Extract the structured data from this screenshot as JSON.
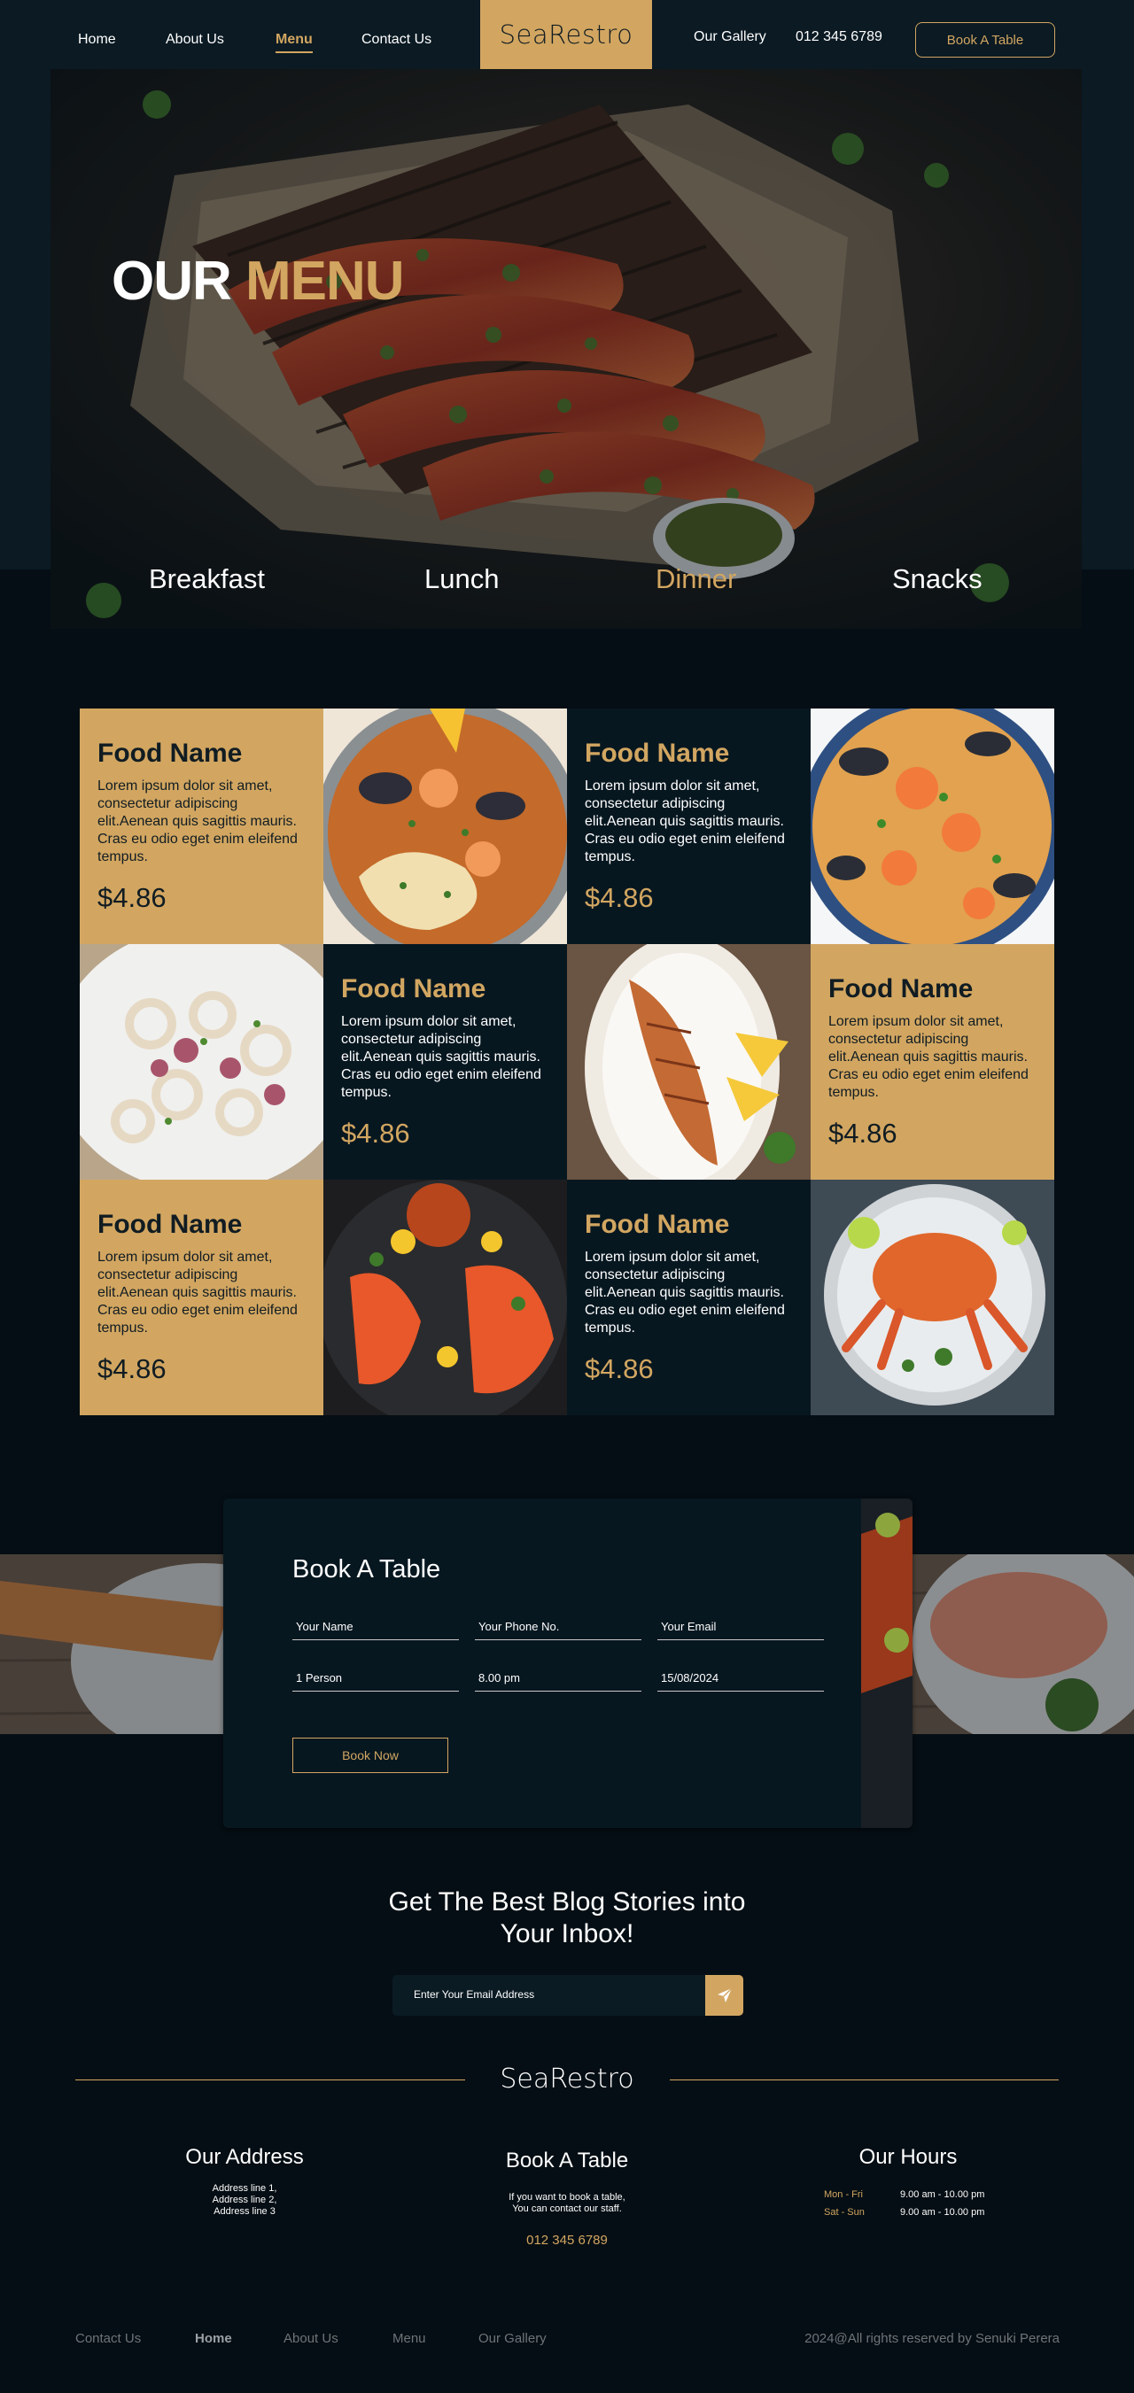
{
  "nav": {
    "links": [
      "Home",
      "About Us",
      "Menu",
      "Contact Us"
    ],
    "active": "Menu",
    "brand": "SeaRestro",
    "gallery": "Our Gallery",
    "phone": "012 345 6789",
    "cta": "Book A Table"
  },
  "hero": {
    "title_part1": "OUR",
    "title_part2": "MENU",
    "categories": [
      "Breakfast",
      "Lunch",
      "Dinner",
      "Snacks"
    ],
    "active_category": "Dinner"
  },
  "menu": {
    "items": [
      {
        "name": "Food Name",
        "description": "Lorem ipsum dolor sit amet, consectetur adipiscing elit.Aenean quis sagittis mauris. Cras eu odio eget enim eleifend tempus.",
        "price": "$4.86"
      },
      {
        "name": "Food Name",
        "description": "Lorem ipsum dolor sit amet, consectetur adipiscing elit.Aenean quis sagittis mauris. Cras eu odio eget enim eleifend tempus.",
        "price": "$4.86"
      },
      {
        "name": "Food Name",
        "description": "Lorem ipsum dolor sit amet, consectetur adipiscing elit.Aenean quis sagittis mauris. Cras eu odio eget enim eleifend tempus.",
        "price": "$4.86"
      },
      {
        "name": "Food Name",
        "description": "Lorem ipsum dolor sit amet, consectetur adipiscing elit.Aenean quis sagittis mauris. Cras eu odio eget enim eleifend tempus.",
        "price": "$4.86"
      },
      {
        "name": "Food Name",
        "description": "Lorem ipsum dolor sit amet, consectetur adipiscing elit.Aenean quis sagittis mauris. Cras eu odio eget enim eleifend tempus.",
        "price": "$4.86"
      },
      {
        "name": "Food Name",
        "description": "Lorem ipsum dolor sit amet, consectetur adipiscing elit.Aenean quis sagittis mauris. Cras eu odio eget enim eleifend tempus.",
        "price": "$4.86"
      }
    ]
  },
  "booking": {
    "title": "Book A Table",
    "fields": {
      "name": "Your Name",
      "phone": "Your Phone No.",
      "email": "Your Email",
      "guests": "1 Person",
      "time": "8.00 pm",
      "date": "15/08/2024"
    },
    "submit": "Book Now"
  },
  "newsletter": {
    "title_line1": "Get The Best Blog Stories into",
    "title_line2": "Your Inbox!",
    "placeholder": "Enter Your Email Address",
    "button_icon": "send-icon"
  },
  "footer": {
    "brand": "SeaRestro",
    "address": {
      "title": "Our Address",
      "line1": "Address line 1,",
      "line2": "Address line 2,",
      "line3": "Address line 3"
    },
    "booking": {
      "title": "Book A Table",
      "text1": "If you want to book a table,",
      "text2": "You can contact our staff.",
      "phone": "012 345 6789"
    },
    "hours": {
      "title": "Our Hours",
      "rows": [
        {
          "day": "Mon - Fri",
          "time": "9.00 am - 10.00 pm"
        },
        {
          "day": "Sat - Sun",
          "time": "9.00 am - 10.00 pm"
        }
      ]
    },
    "links": [
      "Contact Us",
      "Home",
      "About Us",
      "Menu",
      "Our Gallery"
    ],
    "active_link": "Home",
    "copyright": "2024@All rights reserved by Senuki Perera"
  },
  "colors": {
    "accent": "#d2a661",
    "background": "#050e14",
    "panel": "#071720"
  }
}
